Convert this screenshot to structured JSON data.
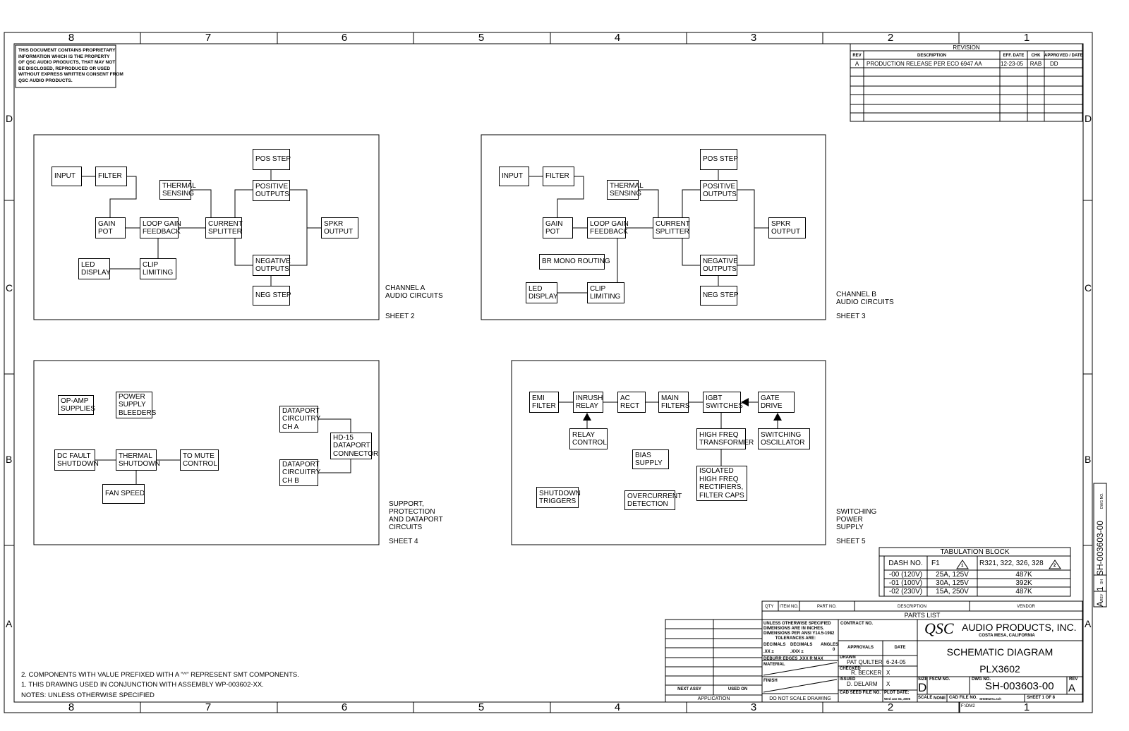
{
  "zones": {
    "columns": [
      "8",
      "7",
      "6",
      "5",
      "4",
      "3",
      "2",
      "1"
    ],
    "rows": [
      "D",
      "C",
      "B",
      "A"
    ]
  },
  "proprietary_notice": "THIS DOCUMENT CONTAINS PROPRIETARY\nINFORMATION WHICH IS THE PROPERTY\nOF QSC AUDIO PRODUCTS, THAT MAY NOT\nBE DISCLOSED, REPRODUCED OR USED\nWITHOUT EXPRESS WRITTEN CONSENT FROM\nQSC AUDIO PRODUCTS.",
  "revision": {
    "title": "REVISION",
    "headers": [
      "REV",
      "DESCRIPTION",
      "EFF. DATE",
      "CHK",
      "APPROVED / DATE"
    ],
    "rows": [
      [
        "A",
        "PRODUCTION RELEASE PER ECO 6947 AA",
        "12-23-05",
        "RAB",
        "DD"
      ]
    ]
  },
  "channel_a": {
    "blocks": [
      "INPUT",
      "FILTER",
      "POS STEP",
      "THERMAL\nSENSING",
      "POSITIVE\nOUTPUTS",
      "GAIN\nPOT",
      "LOOP GAIN\nFEEDBACK",
      "CURRENT\nSPLITTER",
      "SPKR\nOUTPUT",
      "LED\nDISPLAY",
      "CLIP\nLIMITING",
      "NEGATIVE\nOUTPUTS",
      "NEG STEP"
    ],
    "caption": "CHANNEL A\nAUDIO CIRCUITS",
    "sheet": "SHEET 2"
  },
  "channel_b": {
    "blocks": [
      "INPUT",
      "FILTER",
      "POS STEP",
      "THERMAL\nSENSING",
      "POSITIVE\nOUTPUTS",
      "GAIN\nPOT",
      "LOOP GAIN\nFEEDBACK",
      "CURRENT\nSPLITTER",
      "SPKR\nOUTPUT",
      "LED\nDISPLAY",
      "CLIP\nLIMITING",
      "NEGATIVE\nOUTPUTS",
      "NEG STEP",
      "BR MONO ROUTING"
    ],
    "caption": "CHANNEL B\nAUDIO CIRCUITS",
    "sheet": "SHEET 3"
  },
  "support": {
    "blocks": [
      "OP-AMP\nSUPPLIES",
      "POWER\nSUPPLY\nBLEEDERS",
      "DATAPORT\nCIRCUITRY\nCH A",
      "HD-15\nDATAPORT\nCONNECTOR",
      "DATAPORT\nCIRCUITRY\nCH B",
      "DC FAULT\nSHUTDOWN",
      "THERMAL\nSHUTDOWN",
      "TO MUTE\nCONTROL",
      "FAN SPEED"
    ],
    "caption": "SUPPORT,\nPROTECTION\nAND DATAPORT\nCIRCUITS",
    "sheet": "SHEET 4"
  },
  "power_supply": {
    "blocks": [
      "EMI\nFILTER",
      "INRUSH\nRELAY",
      "AC\nRECT",
      "MAIN\nFILTERS",
      "IGBT\nSWITCHES",
      "GATE\nDRIVE",
      "RELAY\nCONTROL",
      "HIGH FREQ\nTRANSFORMER",
      "SWITCHING\nOSCILLATOR",
      "BIAS\nSUPPLY",
      "ISOLATED\nHIGH FREQ\nRECTIFIERS,\nFILTER CAPS",
      "SHUTDOWN\nTRIGGERS",
      "OVERCURRENT\nDETECTION"
    ],
    "caption": "SWITCHING\nPOWER\nSUPPLY",
    "sheet": "SHEET 5"
  },
  "tabulation": {
    "title": "TABULATION BLOCK",
    "headers": [
      "DASH NO.",
      "F1",
      "R321, 322, 326, 328"
    ],
    "header_flags": [
      "1",
      "2"
    ],
    "rows": [
      [
        "-00 (120V)",
        "25A, 125V",
        "487K"
      ],
      [
        "-01 (100V)",
        "30A, 125V",
        "392K"
      ],
      [
        "-02 (230V)",
        "15A, 250V",
        "487K"
      ]
    ]
  },
  "parts_list": {
    "headers": [
      "QTY",
      "ITEM NO.",
      "PART NO.",
      "DESCRIPTION",
      "VENDOR"
    ],
    "title": "PARTS LIST"
  },
  "application": {
    "next_assy": "NEXT ASSY",
    "used_on": "USED ON",
    "title": "APPLICATION"
  },
  "tolerances": {
    "text": "UNLESS OTHERWISE SPECIFIED\nDIMENSIONS ARE IN INCHES.\nDIMENSIONS PER ANSI Y14.5-1982\n          TOLERANCES ARE:",
    "decimals1": "DECIMALS",
    "decimals2": "DECIMALS",
    "angles": "ANGLES",
    "xx": ".XX ±",
    "xxx": ".XXX ±",
    "angle_val": "0",
    "deburr": "DEBURR EDGES .XXX R MAX",
    "material": "MATERIAL",
    "finish": "FINISH",
    "do_not_scale": "DO NOT SCALE DRAWING"
  },
  "approvals": {
    "contract_no": "CONTRACT NO.",
    "approvals": "APPROVALS",
    "date": "DATE",
    "drawn_label": "DRAWN",
    "drawn": "PAT QUILTER",
    "drawn_date": "6-24-05",
    "checked_label": "CHECKED",
    "checked": "R. BECKER",
    "checked_date": "X",
    "issued_label": "ISSUED",
    "issued": "D. DELARM",
    "issued_date": "X",
    "cad_seed": "CAD SEED FILE NO.",
    "plot_date_label": "PLOT DATE:",
    "plot_date": "Wed Jan 04, 2006"
  },
  "title_block": {
    "logo": "QSC",
    "company": "AUDIO PRODUCTS, INC.",
    "location": "COSTA MESA, CALIFORNIA",
    "title": "SCHEMATIC DIAGRAM",
    "model": "PLX3602",
    "size_label": "SIZE",
    "size": "D",
    "fscm_label": "FSCM NO.",
    "dwg_label": "DWG NO.",
    "dwg_no": "SH-003603-00",
    "rev_label": "REV",
    "rev": "A",
    "scale_label": "SCALE",
    "scale": "NONE",
    "cad_file_label": "CAD FILE NO.",
    "cad_file": "SH3602A1.sch",
    "sheet": "SHEET 1 OF 8",
    "path": "F:\\DM2"
  },
  "side_block": {
    "dwg_no": "SH-003603-00",
    "dwg_label": "DWG NO.",
    "sheet": "1",
    "sh_label": "SH",
    "rev": "A",
    "rev_label": "REV"
  },
  "notes": [
    "2. COMPONENTS WITH VALUE PREFIXED WITH A \"^\" REPRESENT SMT COMPONENTS.",
    "1. THIS DRAWING USED IN CONJUNCTION WITH ASSEMBLY WP-003602-XX.",
    "NOTES: UNLESS OTHERWISE SPECIFIED"
  ]
}
